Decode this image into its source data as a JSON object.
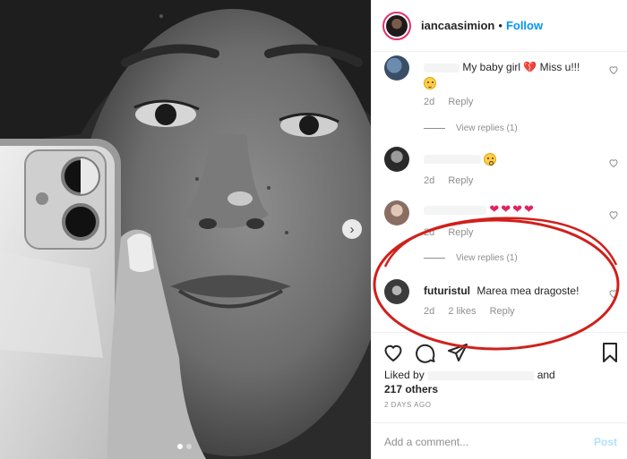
{
  "post": {
    "username": "iancaasimion",
    "separator": "•",
    "follow_label": "Follow",
    "avatar_icon": "profile-avatar"
  },
  "comments": [
    {
      "username": "",
      "text": "My baby girl",
      "emoji": "broken-heart",
      "text_after": "Miss u!!!",
      "time": "2d",
      "reply": "Reply",
      "view_replies": "View replies (1)"
    },
    {
      "username": "",
      "text": "",
      "emoji": "astonished-face",
      "time": "2d",
      "reply": "Reply"
    },
    {
      "username": "",
      "text": "",
      "hearts": "❤❤❤❤",
      "time": "2d",
      "reply": "Reply",
      "view_replies": "View replies (1)"
    },
    {
      "username": "futuristul",
      "text": "Marea mea dragoste!",
      "time": "2d",
      "likes": "2 likes",
      "reply": "Reply"
    }
  ],
  "actions": {
    "like_icon": "heart-icon",
    "comment_icon": "comment-icon",
    "share_icon": "share-icon",
    "save_icon": "bookmark-icon"
  },
  "likes": {
    "prefix": "Liked by",
    "suffix": "and",
    "others": "217 others"
  },
  "timestamp": "2 DAYS AGO",
  "add_comment": {
    "placeholder": "Add a comment...",
    "post_label": "Post"
  },
  "colors": {
    "accent": "#0095f6",
    "annotation": "#d0201c",
    "heart": "#e0245e"
  }
}
